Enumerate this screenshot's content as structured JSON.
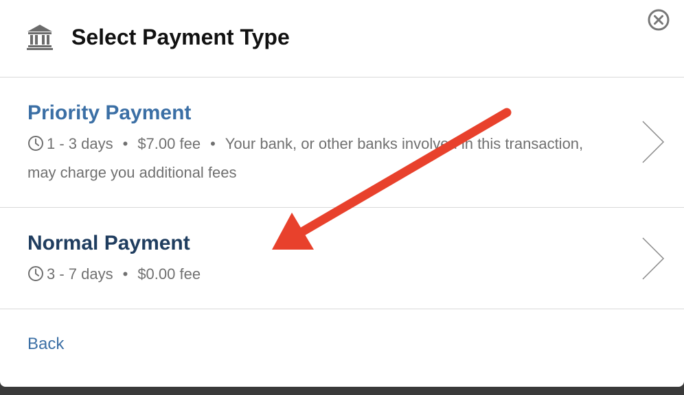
{
  "header": {
    "title": "Select Payment Type",
    "icon": "bank-icon",
    "close_icon": "close-circle-icon"
  },
  "options": [
    {
      "title": "Priority Payment",
      "time": "1 - 3 days",
      "fee": "$7.00 fee",
      "note": "Your bank, or other banks involved in this transaction, may charge you additional fees",
      "icon": "clock-icon"
    },
    {
      "title": "Normal Payment",
      "time": "3 - 7 days",
      "fee": "$0.00 fee",
      "icon": "clock-icon"
    }
  ],
  "footer": {
    "back_label": "Back"
  },
  "colors": {
    "priority_title": "#3b6fa5",
    "normal_title": "#1f3d5f",
    "annotation_arrow": "#e8412c",
    "detail_text": "#707070"
  },
  "separator": "•"
}
